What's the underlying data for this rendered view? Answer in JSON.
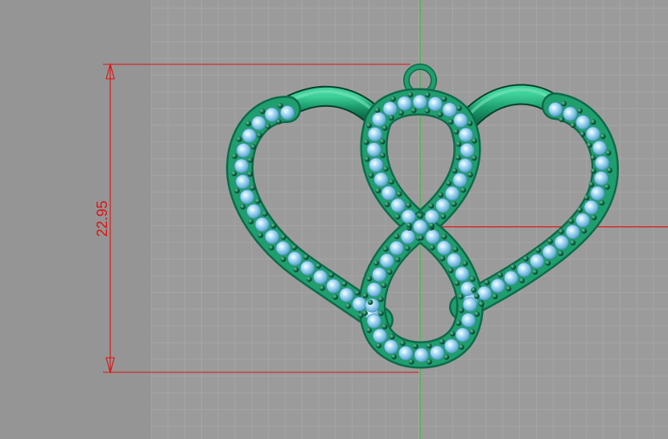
{
  "viewport": {
    "name": "cad-viewport",
    "background_color": "#9b9b9b",
    "grid_minor_color": "#a6a6a6",
    "grid_major_color": "#b0b0b0",
    "axis_color": "#38c038",
    "dimension_color": "#e01010"
  },
  "dimension": {
    "value": "22.95",
    "orientation": "vertical"
  },
  "model": {
    "name": "heart-infinity-pendant",
    "metal_color": "#1f9e6e",
    "metal_dark": "#0e6a4a",
    "stone_color": "#9cd4f0",
    "stone_highlight": "#e3f4ff",
    "prong_color": "#0b4a34"
  }
}
